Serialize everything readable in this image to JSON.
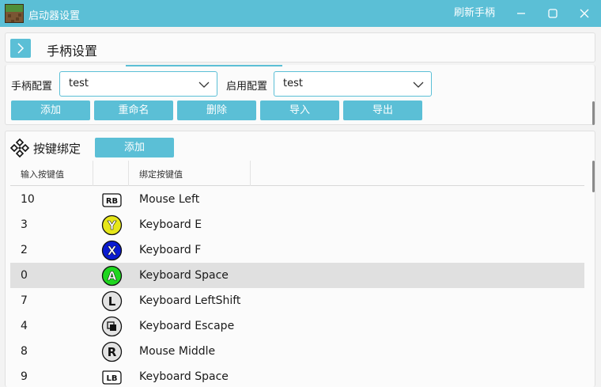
{
  "window": {
    "title": "启动器设置",
    "refresh_label": "刷新手柄",
    "accent": "#5bbfd6"
  },
  "header": {
    "title": "手柄设置"
  },
  "config": {
    "gamepad_label": "手柄配置",
    "gamepad_value": "test",
    "enabled_label": "启用配置",
    "enabled_value": "test",
    "buttons": [
      "添加",
      "重命名",
      "删除",
      "导入",
      "导出"
    ]
  },
  "bindings": {
    "title": "按键绑定",
    "add_label": "添加",
    "columns": [
      "输入按键值",
      "",
      "绑定按键值"
    ],
    "rows": [
      {
        "input": "10",
        "icon": "rb-icon",
        "glyph": "RB",
        "bind": "Mouse Left",
        "selected": false
      },
      {
        "input": "3",
        "icon": "y-button-icon",
        "glyph": "Y",
        "bind": "Keyboard E",
        "selected": false
      },
      {
        "input": "2",
        "icon": "x-button-icon",
        "glyph": "X",
        "bind": "Keyboard F",
        "selected": false
      },
      {
        "input": "0",
        "icon": "a-button-icon",
        "glyph": "A",
        "bind": "Keyboard Space",
        "selected": true
      },
      {
        "input": "7",
        "icon": "left-stick-icon",
        "glyph": "L",
        "bind": "Keyboard LeftShift",
        "selected": false
      },
      {
        "input": "4",
        "icon": "view-button-icon",
        "glyph": "",
        "bind": "Keyboard Escape",
        "selected": false
      },
      {
        "input": "8",
        "icon": "right-stick-icon",
        "glyph": "R",
        "bind": "Mouse Middle",
        "selected": false
      },
      {
        "input": "9",
        "icon": "lb-icon",
        "glyph": "LB",
        "bind": "Keyboard Space",
        "selected": false
      }
    ]
  },
  "colors": {
    "y_button": "#e6e619",
    "x_button": "#0a1bd0",
    "a_button": "#1fd61f",
    "gray_button": "#e3e3e3",
    "selected_row": "#e0e0e0"
  }
}
